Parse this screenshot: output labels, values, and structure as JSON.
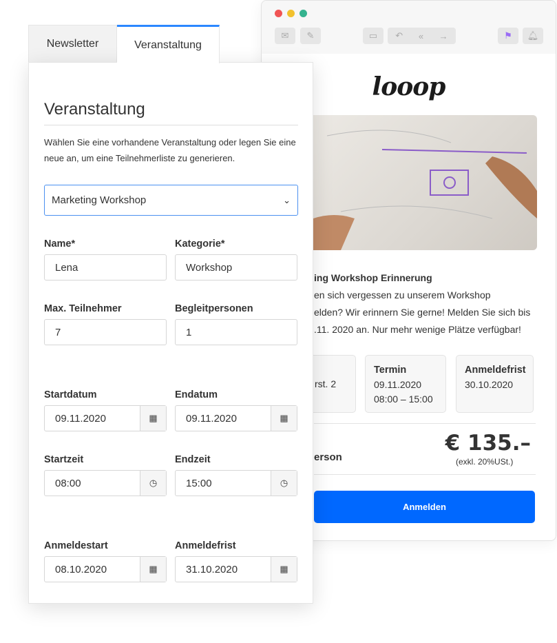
{
  "email": {
    "window_dots": [
      "#f05454",
      "#f2c12e",
      "#35b38f"
    ],
    "toolbar": {
      "icons": [
        "envelope-icon",
        "compose-icon",
        "archive-icon",
        "reply-icon",
        "reply-all-icon",
        "forward-icon",
        "flag-icon",
        "bell-icon"
      ],
      "flag_color": "#9b6cf5"
    },
    "logo": "looop",
    "heading": "ing Workshop Erinnerung",
    "body_lines": [
      "en sich vergessen zu unserem Workshop",
      "elden? Wir erinnern Sie gerne! Melden Sie sich bis",
      ".11. 2020 an. Nur mehr wenige Plätze verfügbar!"
    ],
    "cards": [
      {
        "title": "",
        "lines": [
          "rst. 2"
        ]
      },
      {
        "title": "Termin",
        "lines": [
          "09.11.2020",
          "08:00 – 15:00"
        ]
      },
      {
        "title": "Anmeldefrist",
        "lines": [
          "30.10.2020"
        ]
      }
    ],
    "price_label": "erson",
    "price": "€ 135.–",
    "price_note": "(exkl.  20%USt.)",
    "register_button": "Anmelden",
    "accent": "#0068ff"
  },
  "tabs": [
    {
      "label": "Newsletter",
      "active": false
    },
    {
      "label": "Veranstaltung",
      "active": true
    }
  ],
  "form": {
    "title": "Veranstaltung",
    "description": "Wählen Sie eine vorhandene Veranstaltung oder legen Sie eine neue an, um eine Teilnehmerliste zu generieren.",
    "event_select": "Marketing Workshop",
    "fields": {
      "name": {
        "label": "Name*",
        "value": "Lena"
      },
      "kategorie": {
        "label": "Kategorie*",
        "value": "Workshop"
      },
      "max": {
        "label": "Max. Teilnehmer",
        "value": "7"
      },
      "begleit": {
        "label": "Begleitpersonen",
        "value": "1"
      },
      "startdatum": {
        "label": "Startdatum",
        "value": "09.11.2020"
      },
      "endatum": {
        "label": "Endatum",
        "value": "09.11.2020"
      },
      "startzeit": {
        "label": "Startzeit",
        "value": "08:00"
      },
      "endzeit": {
        "label": "Endzeit",
        "value": "15:00"
      },
      "anmeldestart": {
        "label": "Anmeldestart",
        "value": "08.10.2020"
      },
      "anmeldefrist": {
        "label": "Anmeldefrist",
        "value": "31.10.2020"
      }
    }
  }
}
